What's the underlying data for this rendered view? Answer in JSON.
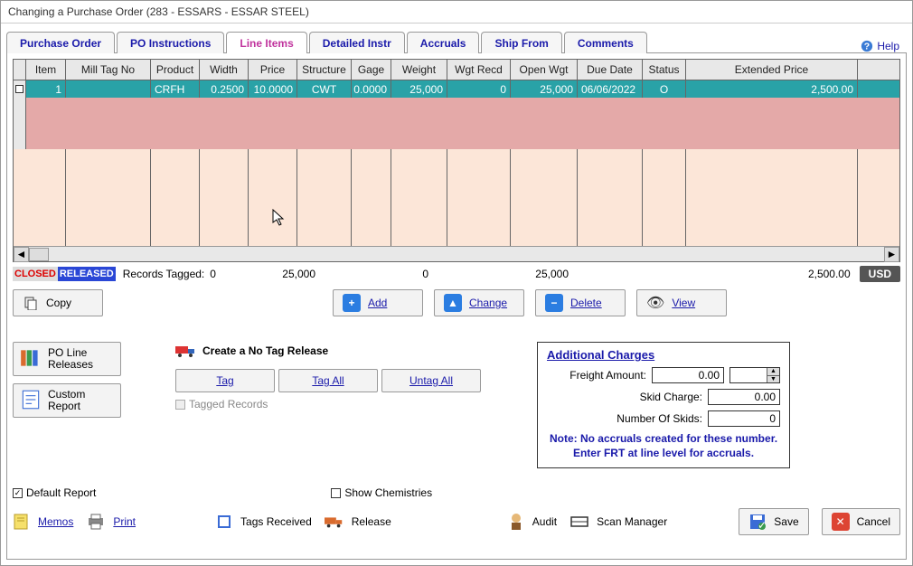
{
  "window": {
    "title": "Changing a Purchase Order  (283 - ESSARS -  ESSAR STEEL)"
  },
  "help_label": "Help",
  "tabs": {
    "po": "Purchase Order",
    "instr": "PO Instructions",
    "line": "Line Items",
    "detail": "Detailed Instr",
    "accruals": "Accruals",
    "ship": "Ship From",
    "comments": "Comments"
  },
  "grid": {
    "headers": {
      "item": "Item",
      "mill": "Mill Tag No",
      "prod": "Product",
      "width": "Width",
      "price": "Price",
      "struct": "Structure",
      "gage": "Gage",
      "weight": "Weight",
      "wgtr": "Wgt Recd",
      "open": "Open Wgt",
      "due": "Due Date",
      "status": "Status",
      "ext": "Extended Price"
    },
    "rows": [
      {
        "item": "1",
        "mill": "",
        "prod": "CRFH",
        "width": "0.2500",
        "price": "10.0000",
        "struct": "CWT",
        "gage": "0.0000",
        "weight": "25,000",
        "wgtr": "0",
        "open": "25,000",
        "due": "06/06/2022",
        "status": "O",
        "ext": "2,500.00"
      }
    ]
  },
  "summary": {
    "closed": "CLOSED",
    "released": "RELEASED",
    "records_tagged_label": "Records Tagged:",
    "records_tagged": "0",
    "tot_weight": "25,000",
    "tot_recd": "0",
    "tot_open": "25,000",
    "tot_ext": "2,500.00",
    "currency": "USD"
  },
  "actions": {
    "copy": "Copy",
    "add": "Add",
    "change": "Change",
    "delete": "Delete",
    "view": "View"
  },
  "left": {
    "po_line_releases": "PO Line Releases",
    "custom_report": "Custom Report"
  },
  "tags": {
    "create": "Create a No Tag Release",
    "tag": "Tag",
    "tag_all": "Tag All",
    "untag_all": "Untag All",
    "tagged_records": "Tagged Records"
  },
  "charges": {
    "title": "Additional Charges",
    "freight_label": "Freight Amount:",
    "skid_label": "Skid Charge:",
    "num_label": "Number Of Skids:",
    "freight": "0.00",
    "skid": "0.00",
    "num": "0",
    "note1": "Note: No accruals created for these number.",
    "note2": "Enter FRT at line level for accruals."
  },
  "checks": {
    "default_report": "Default Report",
    "show_chem": "Show Chemistries"
  },
  "footer": {
    "memos": "Memos",
    "print": "Print",
    "tags_received": "Tags Received",
    "release": "Release",
    "audit": "Audit",
    "scan_mgr": "Scan Manager",
    "save": "Save",
    "cancel": "Cancel"
  }
}
